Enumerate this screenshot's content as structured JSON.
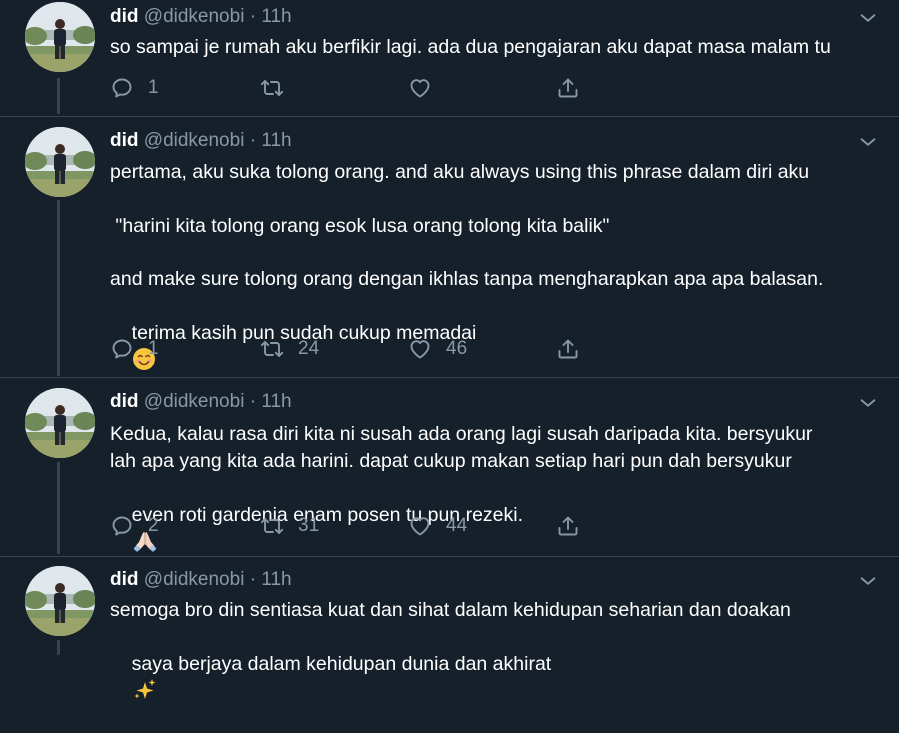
{
  "tweets": [
    {
      "name": "did",
      "handle": "@didkenobi",
      "dot": "·",
      "time": "11h",
      "text": "so sampai je rumah aku berfikir lagi. ada dua pengajaran aku dapat masa malam tu",
      "reply_count": "1",
      "retweet_count": "",
      "like_count": ""
    },
    {
      "name": "did",
      "handle": "@didkenobi",
      "dot": "·",
      "time": "11h",
      "text_line1": "pertama, aku suka tolong orang. and aku always using this phrase dalam diri aku",
      "text_line2": " \"harini kita tolong orang esok lusa orang tolong kita balik\"",
      "text_line3": "and make sure tolong orang dengan ikhlas tanpa mengharapkan apa apa balasan.",
      "text_line4": "terima kasih pun sudah cukup memadai",
      "reply_count": "1",
      "retweet_count": "24",
      "like_count": "46"
    },
    {
      "name": "did",
      "handle": "@didkenobi",
      "dot": "·",
      "time": "11h",
      "text_line1": "Kedua, kalau rasa diri kita ni susah ada orang lagi susah daripada kita. bersyukur",
      "text_line2": "lah apa yang kita ada harini. dapat cukup makan setiap hari pun dah bersyukur",
      "text_line3": "even roti gardenia enam posen tu pun rezeki.",
      "reply_count": "2",
      "retweet_count": "31",
      "like_count": "44"
    },
    {
      "name": "did",
      "handle": "@didkenobi",
      "dot": "·",
      "time": "11h",
      "text_line1": "semoga bro din sentiasa kuat dan sihat dalam kehidupan seharian dan doakan",
      "text_line2": "saya berjaya dalam kehidupan dunia dan akhirat"
    }
  ],
  "icons": {
    "reply": "reply-icon",
    "retweet": "retweet-icon",
    "like": "heart-icon",
    "share": "share-icon",
    "caret": "chevron-down-icon"
  },
  "colors": {
    "background": "#15202b",
    "secondary_text": "#8899a6",
    "divider": "#38444d"
  }
}
